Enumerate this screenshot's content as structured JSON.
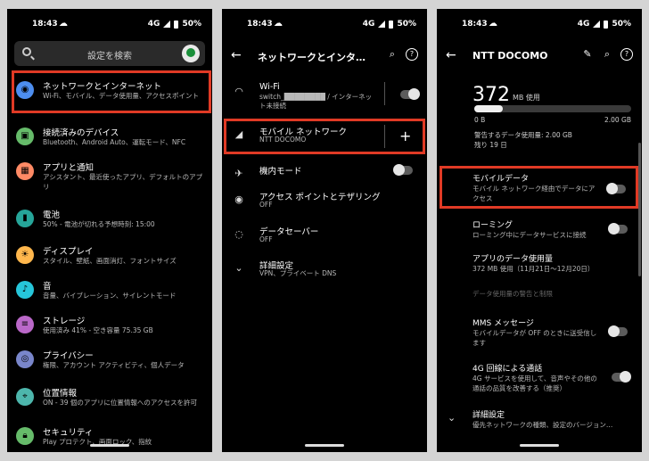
{
  "status": {
    "time": "18:43",
    "network": "4G",
    "battery": "50%"
  },
  "phone1": {
    "search_placeholder": "設定を検索",
    "items": [
      {
        "title": "ネットワークとインターネット",
        "subtitle": "Wi-Fi、モバイル、データ使用量、アクセスポイント",
        "icon": "wifi-icon",
        "color": "#4d8ef0"
      },
      {
        "title": "接続済みのデバイス",
        "subtitle": "Bluetooth、Android Auto、運転モード、NFC",
        "icon": "devices-icon",
        "color": "#66bb6a"
      },
      {
        "title": "アプリと通知",
        "subtitle": "アシスタント、最近使ったアプリ、デフォルトのアプリ",
        "icon": "apps-icon",
        "color": "#ff8a65"
      },
      {
        "title": "電池",
        "subtitle": "50% - 電池が切れる予想時刻: 15:00",
        "icon": "battery-icon",
        "color": "#26a69a"
      },
      {
        "title": "ディスプレイ",
        "subtitle": "スタイル、壁紙、画面消灯、フォントサイズ",
        "icon": "display-icon",
        "color": "#ffb74d"
      },
      {
        "title": "音",
        "subtitle": "音量、バイブレーション、サイレントモード",
        "icon": "sound-icon",
        "color": "#26c6da"
      },
      {
        "title": "ストレージ",
        "subtitle": "使用済み 41% - 空き容量 75.35 GB",
        "icon": "storage-icon",
        "color": "#ba68c8"
      },
      {
        "title": "プライバシー",
        "subtitle": "権限、アカウント アクティビティ、個人データ",
        "icon": "privacy-icon",
        "color": "#7986cb"
      },
      {
        "title": "位置情報",
        "subtitle": "ON - 39 個のアプリに位置情報へのアクセスを許可",
        "icon": "location-icon",
        "color": "#4db6ac"
      },
      {
        "title": "セキュリティ",
        "subtitle": "Play プロテクト、画面ロック、指紋",
        "icon": "security-icon",
        "color": "#66bb6a"
      }
    ]
  },
  "phone2": {
    "title": "ネットワークとインタ…",
    "wifi": {
      "title": "Wi-Fi",
      "subtitle": "switch_████████ / インターネット未接続"
    },
    "mobile": {
      "title": "モバイル ネットワーク",
      "subtitle": "NTT DOCOMO"
    },
    "airplane": {
      "title": "機内モード"
    },
    "hotspot": {
      "title": "アクセス ポイントとテザリング",
      "subtitle": "OFF"
    },
    "datasaver": {
      "title": "データセーバー",
      "subtitle": "OFF"
    },
    "advanced": {
      "title": "詳細設定",
      "subtitle": "VPN、プライベート DNS"
    }
  },
  "phone3": {
    "title": "NTT DOCOMO",
    "usage_value": "372",
    "usage_unit": "MB 使用",
    "usage_fraction": 0.18,
    "bar_min": "0 B",
    "bar_max": "2.00 GB",
    "warning": "警告するデータ使用量: 2.00 GB",
    "remaining": "残り 19 日",
    "mobile_data": {
      "title": "モバイルデータ",
      "subtitle": "モバイル ネットワーク経由でデータにアクセス"
    },
    "roaming": {
      "title": "ローミング",
      "subtitle": "ローミング中にデータサービスに接続"
    },
    "app_usage": {
      "title": "アプリのデータ使用量",
      "subtitle": "372 MB 使用（11月21日〜12月20日）"
    },
    "data_warning": "データ使用量の警告と制限",
    "mms": {
      "title": "MMS メッセージ",
      "subtitle": "モバイルデータが OFF のときに送受信します"
    },
    "volte": {
      "title": "4G 回線による通話",
      "subtitle": "4G サービスを使用して、音声やその他の通話の品質を改善する（推奨）"
    },
    "advanced": {
      "title": "詳細設定",
      "subtitle": "優先ネットワークの種類、設定のバージョン…"
    }
  }
}
